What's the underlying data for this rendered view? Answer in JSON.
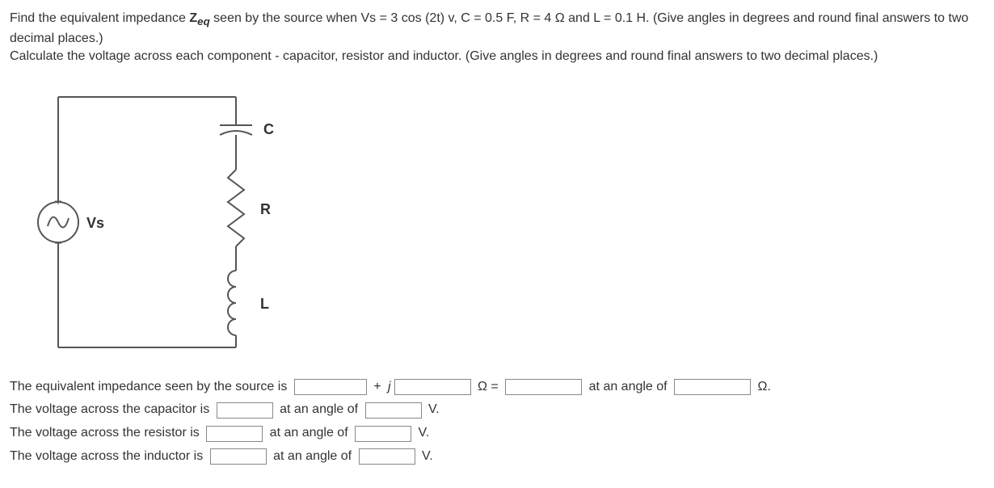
{
  "problem": {
    "line1_pre": "Find the equivalent impedance ",
    "line1_symbol_bold": "Z",
    "line1_symbol_sub": "eq",
    "line1_post": " seen by the source when Vs = 3 cos (2t) v, C = 0.5 F, R = 4 Ω and L = 0.1 H. (Give angles in degrees and round final answers to two decimal places.)",
    "line2": "Calculate the voltage across each component - capacitor, resistor and inductor. (Give angles in degrees and round final answers to two decimal places.)"
  },
  "diagram": {
    "source_label": "Vs",
    "c_label": "C",
    "r_label": "R",
    "l_label": "L"
  },
  "answers": {
    "zeq": {
      "pre": "The equivalent impedance seen by the source is ",
      "plus_j": " + ",
      "j_sym": "j",
      "ohm_eq": " Ω = ",
      "angle_txt": " at an angle of ",
      "ohm_end": " Ω."
    },
    "vcap": {
      "pre": "The voltage across the capacitor is ",
      "angle_txt": " at an angle of ",
      "end": " V."
    },
    "vres": {
      "pre": "The voltage across the resistor is ",
      "angle_txt": " at an angle of ",
      "end": " V."
    },
    "vind": {
      "pre": "The voltage across the inductor is ",
      "angle_txt": " at an angle of ",
      "end": " V."
    }
  }
}
